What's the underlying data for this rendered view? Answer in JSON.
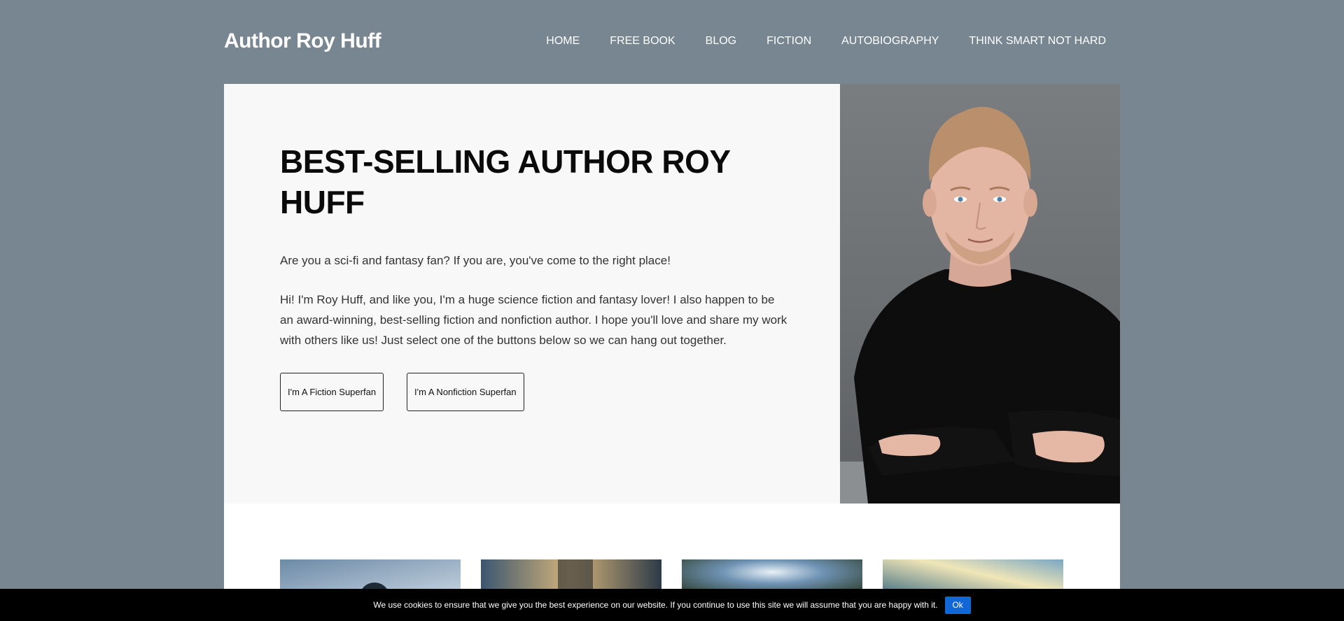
{
  "site": {
    "title": "Author Roy Huff"
  },
  "nav": {
    "items": [
      {
        "label": "HOME"
      },
      {
        "label": "FREE BOOK"
      },
      {
        "label": "BLOG"
      },
      {
        "label": "FICTION"
      },
      {
        "label": "AUTOBIOGRAPHY"
      },
      {
        "label": "THINK SMART NOT HARD"
      }
    ]
  },
  "hero": {
    "title": "BEST-SELLING AUTHOR ROY HUFF",
    "intro": "Are you a sci-fi and fantasy fan? If you are, you've come to the right place!",
    "body": "Hi! I'm Roy Huff, and like you, I'm a huge science fiction and fantasy lover! I also happen to be an award-winning, best-selling fiction and nonfiction author. I hope you'll love and share my work with others like us! Just select one of the buttons below so we can hang out together.",
    "buttons": [
      {
        "label": "I'm A Fiction Superfan"
      },
      {
        "label": "I'm A Nonfiction Superfan"
      }
    ]
  },
  "cookie": {
    "message": "We use cookies to ensure that we give you the best experience on our website. If you continue to use this site we will assume that you are happy with it.",
    "ok_label": "Ok"
  },
  "colors": {
    "page_background": "#788691",
    "hero_panel": "#f8f8f8",
    "cookie_button": "#1167d6"
  }
}
